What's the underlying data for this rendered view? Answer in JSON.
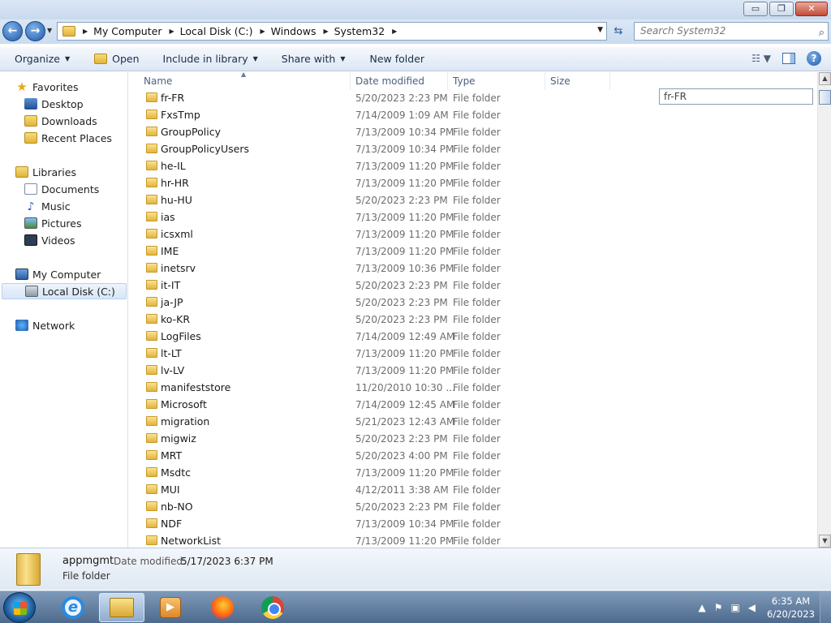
{
  "window": {
    "controls": {
      "minimize": "▭",
      "maximize": "❐",
      "close": "✕"
    }
  },
  "address": {
    "crumbs": [
      "My Computer",
      "Local Disk (C:)",
      "Windows",
      "System32"
    ],
    "search_placeholder": "Search System32"
  },
  "toolbar": {
    "organize": "Organize",
    "open": "Open",
    "include_in_library": "Include in library",
    "share_with": "Share with",
    "new_folder": "New folder"
  },
  "nav": {
    "favorites": "Favorites",
    "desktop": "Desktop",
    "downloads": "Downloads",
    "recent_places": "Recent Places",
    "libraries": "Libraries",
    "documents": "Documents",
    "music": "Music",
    "pictures": "Pictures",
    "videos": "Videos",
    "my_computer": "My Computer",
    "local_disk": "Local Disk (C:)",
    "network": "Network"
  },
  "columns": {
    "name": "Name",
    "date_modified": "Date modified",
    "type": "Type",
    "size": "Size"
  },
  "rename_value": "fr-FR",
  "files": [
    {
      "name": "fr-FR",
      "date": "5/20/2023 2:23 PM",
      "type": "File folder"
    },
    {
      "name": "FxsTmp",
      "date": "7/14/2009 1:09 AM",
      "type": "File folder"
    },
    {
      "name": "GroupPolicy",
      "date": "7/13/2009 10:34 PM",
      "type": "File folder"
    },
    {
      "name": "GroupPolicyUsers",
      "date": "7/13/2009 10:34 PM",
      "type": "File folder"
    },
    {
      "name": "he-IL",
      "date": "7/13/2009 11:20 PM",
      "type": "File folder"
    },
    {
      "name": "hr-HR",
      "date": "7/13/2009 11:20 PM",
      "type": "File folder"
    },
    {
      "name": "hu-HU",
      "date": "5/20/2023 2:23 PM",
      "type": "File folder"
    },
    {
      "name": "ias",
      "date": "7/13/2009 11:20 PM",
      "type": "File folder"
    },
    {
      "name": "icsxml",
      "date": "7/13/2009 11:20 PM",
      "type": "File folder"
    },
    {
      "name": "IME",
      "date": "7/13/2009 11:20 PM",
      "type": "File folder"
    },
    {
      "name": "inetsrv",
      "date": "7/13/2009 10:36 PM",
      "type": "File folder"
    },
    {
      "name": "it-IT",
      "date": "5/20/2023 2:23 PM",
      "type": "File folder"
    },
    {
      "name": "ja-JP",
      "date": "5/20/2023 2:23 PM",
      "type": "File folder"
    },
    {
      "name": "ko-KR",
      "date": "5/20/2023 2:23 PM",
      "type": "File folder"
    },
    {
      "name": "LogFiles",
      "date": "7/14/2009 12:49 AM",
      "type": "File folder"
    },
    {
      "name": "lt-LT",
      "date": "7/13/2009 11:20 PM",
      "type": "File folder"
    },
    {
      "name": "lv-LV",
      "date": "7/13/2009 11:20 PM",
      "type": "File folder"
    },
    {
      "name": "manifeststore",
      "date": "11/20/2010 10:30 ...",
      "type": "File folder"
    },
    {
      "name": "Microsoft",
      "date": "7/14/2009 12:45 AM",
      "type": "File folder"
    },
    {
      "name": "migration",
      "date": "5/21/2023 12:43 AM",
      "type": "File folder"
    },
    {
      "name": "migwiz",
      "date": "5/20/2023 2:23 PM",
      "type": "File folder"
    },
    {
      "name": "MRT",
      "date": "5/20/2023 4:00 PM",
      "type": "File folder"
    },
    {
      "name": "Msdtc",
      "date": "7/13/2009 11:20 PM",
      "type": "File folder"
    },
    {
      "name": "MUI",
      "date": "4/12/2011 3:38 AM",
      "type": "File folder"
    },
    {
      "name": "nb-NO",
      "date": "5/20/2023 2:23 PM",
      "type": "File folder"
    },
    {
      "name": "NDF",
      "date": "7/13/2009 10:34 PM",
      "type": "File folder"
    },
    {
      "name": "NetworkList",
      "date": "7/13/2009 11:20 PM",
      "type": "File folder"
    }
  ],
  "details": {
    "name": "appmgmt",
    "modified_label": "Date modified:",
    "modified_value": "5/17/2023 6:37 PM",
    "type": "File folder"
  },
  "taskbar": {
    "time": "6:35 AM",
    "date": "6/20/2023"
  }
}
